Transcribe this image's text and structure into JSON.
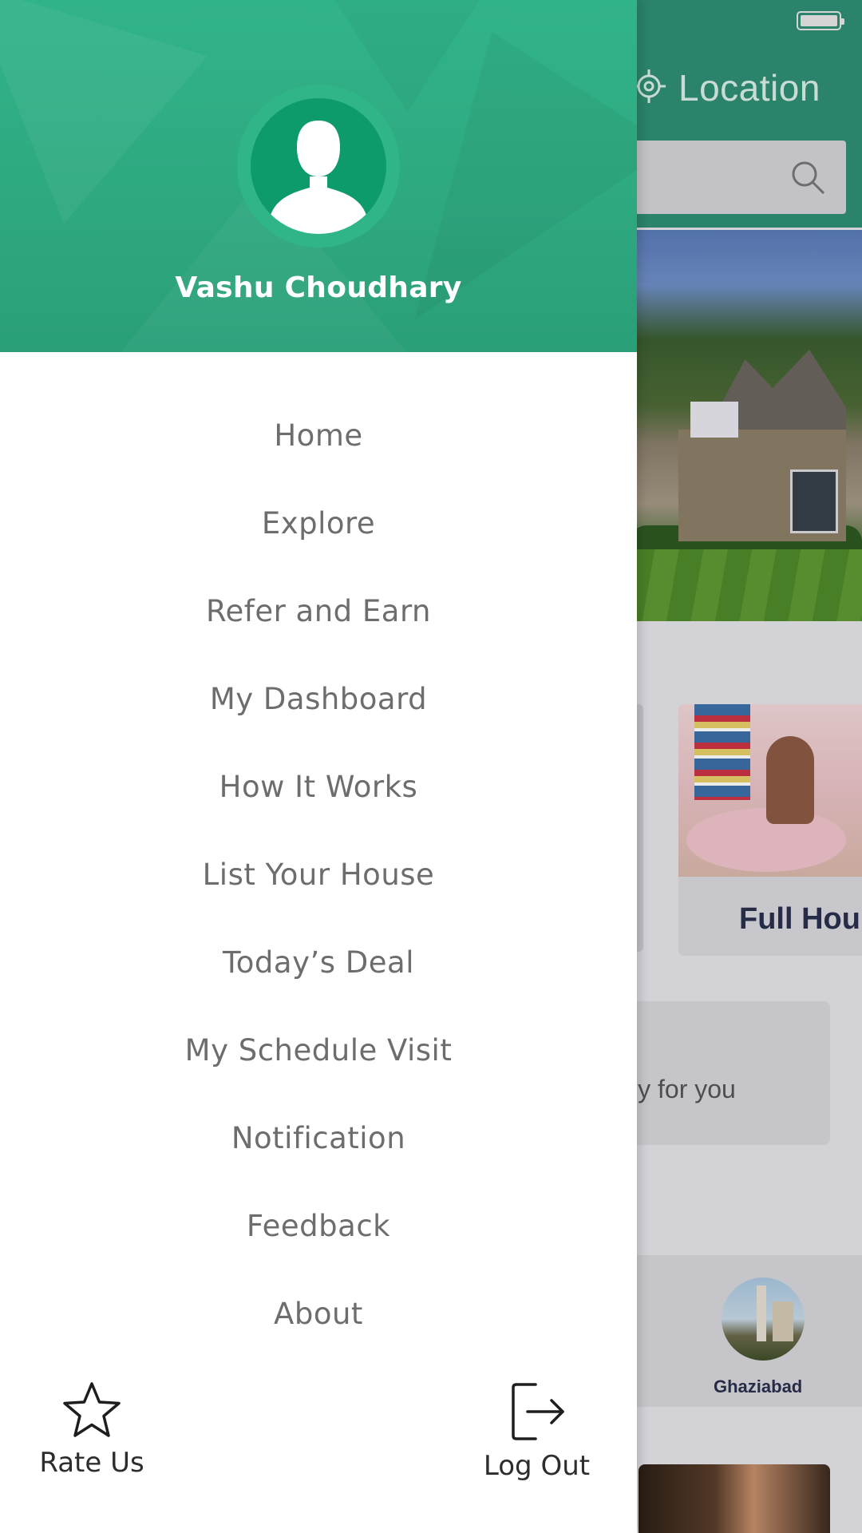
{
  "background_app": {
    "header": {
      "location_label": "Location"
    },
    "category_card": {
      "title": "Full Hou"
    },
    "offer_banner": {
      "text": "ly for you"
    },
    "cities": [
      {
        "name": "Ghaziabad"
      }
    ]
  },
  "drawer": {
    "user": {
      "name": "Vashu Choudhary"
    },
    "menu": [
      {
        "label": "Home"
      },
      {
        "label": "Explore"
      },
      {
        "label": "Refer and Earn"
      },
      {
        "label": "My Dashboard"
      },
      {
        "label": "How It Works"
      },
      {
        "label": "List Your House"
      },
      {
        "label": "Today’s Deal"
      },
      {
        "label": "My Schedule Visit"
      },
      {
        "label": "Notification"
      },
      {
        "label": "Feedback"
      },
      {
        "label": "About"
      }
    ],
    "footer": {
      "rate_label": "Rate Us",
      "rate_icon": "star-icon",
      "logout_label": "Log Out",
      "logout_icon": "logout-icon"
    }
  },
  "colors": {
    "drawer_header": "#2ea87f",
    "app_header": "#2e8f74",
    "menu_text": "#6d6d6d",
    "footer_text": "#2d2d2d"
  }
}
